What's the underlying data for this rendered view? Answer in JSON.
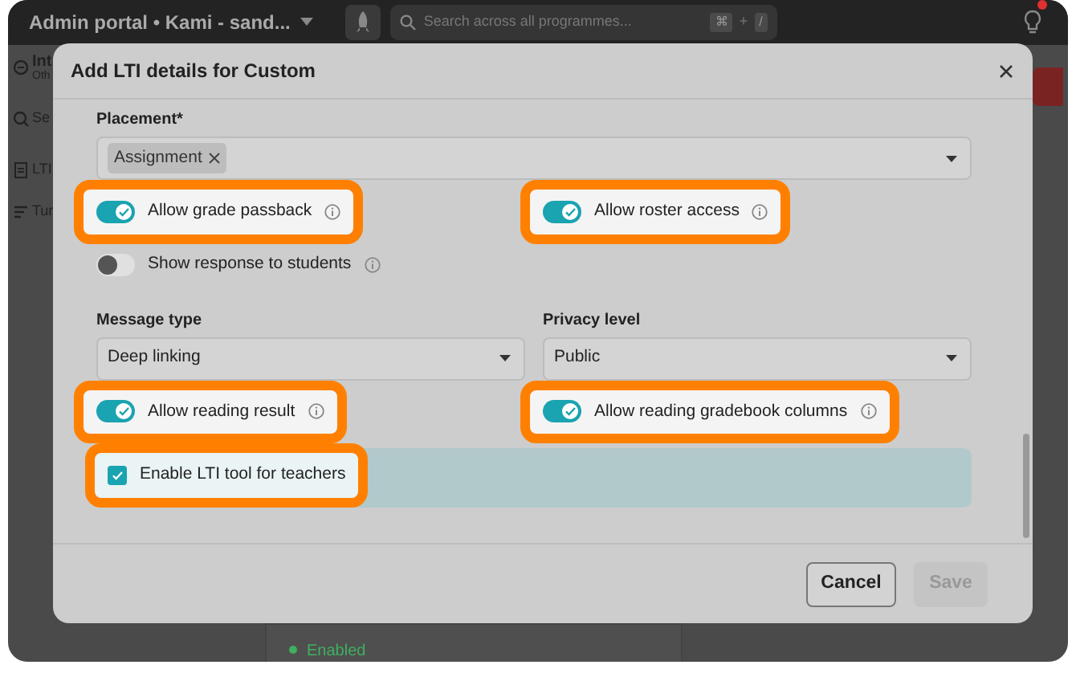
{
  "app_bar": {
    "title": "Admin portal • Kami - sand...",
    "search_placeholder": "Search across all programmes...",
    "shortcut_keys": [
      "⌘",
      "/"
    ],
    "shortcut_joiner": "+",
    "notification": true
  },
  "background": {
    "sidebar": [
      {
        "kind": "header",
        "text": "Int",
        "subtext": "Oth"
      },
      {
        "kind": "search",
        "text": "Se"
      },
      {
        "kind": "doc",
        "text": "LTI"
      },
      {
        "kind": "list",
        "text": "Tur"
      }
    ],
    "status": {
      "text": "Enabled",
      "color": "#3fb060"
    }
  },
  "modal": {
    "title": "Add LTI details for Custom",
    "placement": {
      "label": "Placement*",
      "tags": [
        "Assignment"
      ]
    },
    "rows": [
      {
        "items": [
          {
            "kind": "toggle",
            "label": "Allow grade passback",
            "on": true,
            "highlighted": true
          },
          {
            "kind": "toggle",
            "label": "Allow roster access",
            "on": true,
            "highlighted": true
          }
        ]
      },
      {
        "items": [
          {
            "kind": "toggle",
            "label": "Show response to students",
            "on": false,
            "highlighted": false
          }
        ]
      },
      {
        "items": [
          {
            "kind": "select",
            "label": "Message type",
            "value": "Deep linking"
          },
          {
            "kind": "select",
            "label": "Privacy level",
            "value": "Public"
          }
        ]
      },
      {
        "items": [
          {
            "kind": "toggle",
            "label": "Allow reading result",
            "on": true,
            "highlighted": true
          },
          {
            "kind": "toggle",
            "label": "Allow reading gradebook columns",
            "on": true,
            "highlighted": true
          }
        ]
      },
      {
        "items": [
          {
            "kind": "checkbox",
            "label": "Enable LTI tool for teachers",
            "checked": true,
            "highlighted": true
          }
        ]
      }
    ],
    "buttons": [
      {
        "label": "Cancel",
        "disabled": false
      },
      {
        "label": "Save",
        "disabled": true
      }
    ]
  }
}
